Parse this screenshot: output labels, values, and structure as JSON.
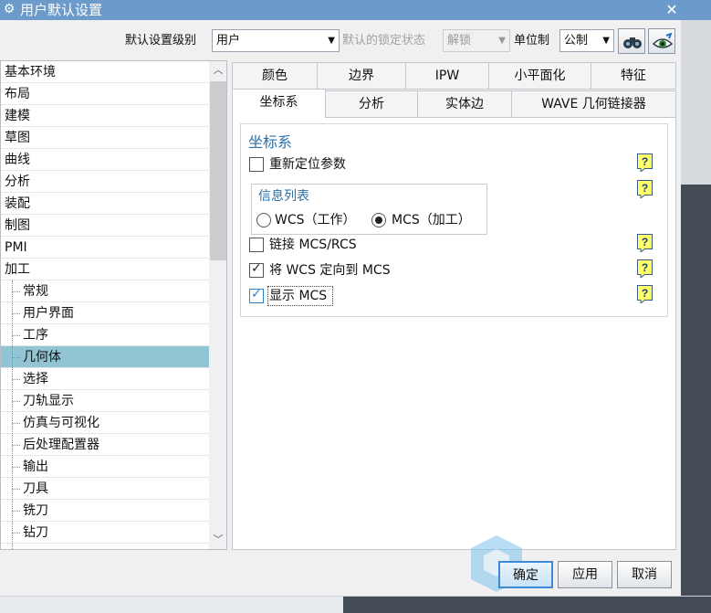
{
  "window": {
    "title": "用户默认设置",
    "close": "✕"
  },
  "toolbar": {
    "default_level_label": "默认设置级别",
    "default_level_value": "用户",
    "lock_state_label": "默认的锁定状态",
    "lock_state_value": "解锁",
    "units_label": "单位制",
    "units_value": "公制"
  },
  "tree": {
    "items": [
      {
        "label": "基本环境",
        "child": false
      },
      {
        "label": "布局",
        "child": false
      },
      {
        "label": "建模",
        "child": false
      },
      {
        "label": "草图",
        "child": false
      },
      {
        "label": "曲线",
        "child": false
      },
      {
        "label": "分析",
        "child": false
      },
      {
        "label": "装配",
        "child": false
      },
      {
        "label": "制图",
        "child": false
      },
      {
        "label": "PMI",
        "child": false
      },
      {
        "label": "加工",
        "child": false
      },
      {
        "label": "常规",
        "child": true
      },
      {
        "label": "用户界面",
        "child": true
      },
      {
        "label": "工序",
        "child": true
      },
      {
        "label": "几何体",
        "child": true,
        "selected": true
      },
      {
        "label": "选择",
        "child": true
      },
      {
        "label": "刀轨显示",
        "child": true
      },
      {
        "label": "仿真与可视化",
        "child": true
      },
      {
        "label": "后处理配置器",
        "child": true
      },
      {
        "label": "输出",
        "child": true
      },
      {
        "label": "刀具",
        "child": true
      },
      {
        "label": "铣刀",
        "child": true
      },
      {
        "label": "钻刀",
        "child": true
      }
    ]
  },
  "tabs": {
    "row1": [
      "颜色",
      "边界",
      "IPW",
      "小平面化",
      "特征"
    ],
    "row2": [
      "坐标系",
      "分析",
      "实体边",
      "WAVE 几何链接器"
    ],
    "active": "坐标系"
  },
  "panel": {
    "group_title": "坐标系",
    "reposition_label": "重新定位参数",
    "reposition_checked": false,
    "info_list_title": "信息列表",
    "radio_wcs_label": "WCS（工作）",
    "radio_mcs_label": "MCS（加工）",
    "radio_selected": "MCS",
    "link_label": "链接 MCS/RCS",
    "link_checked": false,
    "orient_label": "将 WCS 定向到 MCS",
    "orient_checked": true,
    "show_label": "显示 MCS",
    "show_checked": true
  },
  "buttons": {
    "ok": "确定",
    "apply": "应用",
    "cancel": "取消"
  },
  "colors": {
    "titlebar": "#6c9bcb",
    "selected_row": "#92c5d3",
    "group_title": "#2c6fa7"
  }
}
